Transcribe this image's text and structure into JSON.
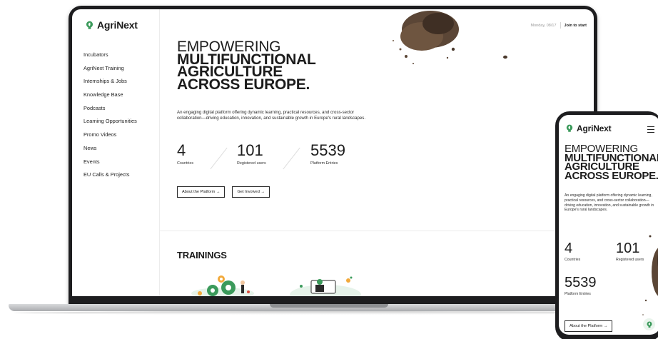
{
  "brand": {
    "name": "AgriNext",
    "accent_color": "#3b9a5b"
  },
  "sidebar": {
    "items": [
      {
        "label": "Incubators"
      },
      {
        "label": "AgriNext Training"
      },
      {
        "label": "Internships & Jobs"
      },
      {
        "label": "Knowledge Base"
      },
      {
        "label": "Podcasts"
      },
      {
        "label": "Learning Opportunities"
      },
      {
        "label": "Promo Videos"
      },
      {
        "label": "News"
      },
      {
        "label": "Events"
      },
      {
        "label": "EU Calls & Projects"
      }
    ]
  },
  "topbar": {
    "date": "Monday, 08/17",
    "join_label": "Join to start"
  },
  "hero": {
    "title_line1": "EMPOWERING",
    "title_line2": "MULTIFUNCTIONAL",
    "title_line3": "AGRICULTURE",
    "title_line4": "ACROSS EUROPE.",
    "description": "An engaging digital platform offering dynamic learning, practical resources, and cross-sector collaboration—driving education, innovation, and sustainable growth in Europe's rural landscapes."
  },
  "stats": [
    {
      "value": "4",
      "label": "Countries"
    },
    {
      "value": "101",
      "label": "Registered users"
    },
    {
      "value": "5539",
      "label": "Platform Entries"
    }
  ],
  "buttons": {
    "about": "About the Platform →",
    "involved": "Get Involved →"
  },
  "sections": {
    "trainings_title": "TRAININGS"
  },
  "mobile": {
    "title_line1": "EMPOWERING",
    "title_line2": "MULTIFUNCTIONAL",
    "title_line3": "AGRICULTURE",
    "title_line4": "ACROSS EUROPE.",
    "description": "An engaging digital platform offering dynamic learning, practical resources, and cross-sector collaboration—driving education, innovation, and sustainable growth in Europe's rural landscapes.",
    "stat_countries_value": "4",
    "stat_countries_label": "Countries",
    "stat_users_value": "101",
    "stat_users_label": "Registered users",
    "stat_entries_value": "5539",
    "stat_entries_label": "Platform Entries",
    "about_button": "About the Platform →"
  },
  "icons": {
    "logo": "lightbulb-leaf-icon",
    "menu": "hamburger-menu-icon",
    "fab": "lightbulb-leaf-icon"
  }
}
